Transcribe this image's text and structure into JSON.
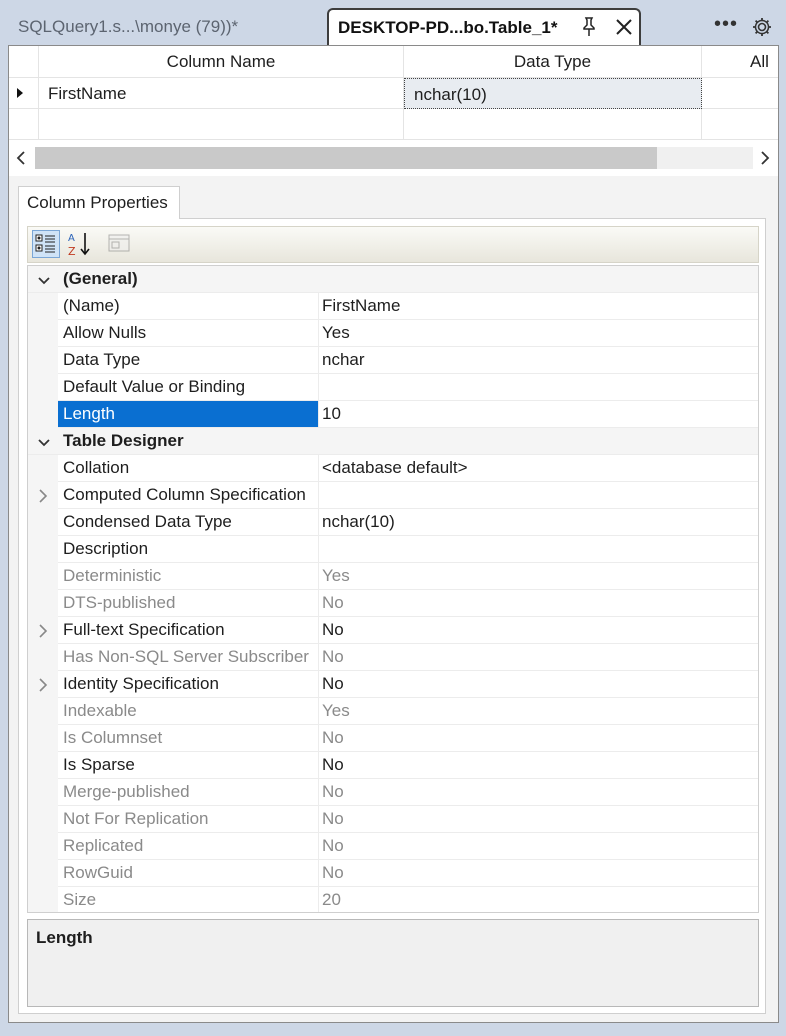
{
  "tabs": [
    {
      "label": "SQLQuery1.s...\\monye (79))*",
      "active": false
    },
    {
      "label": "DESKTOP-PD...bo.Table_1*",
      "active": true
    }
  ],
  "grid": {
    "headers": [
      "Column Name",
      "Data Type",
      "All"
    ],
    "rows": [
      {
        "name": "FirstName",
        "type": "nchar(10)"
      }
    ]
  },
  "column_properties": {
    "tab_label": "Column Properties",
    "categories": [
      {
        "label": "(General)",
        "rows": [
          {
            "name": "(Name)",
            "value": "FirstName",
            "dim": false,
            "expandable": false
          },
          {
            "name": "Allow Nulls",
            "value": "Yes",
            "dim": false,
            "expandable": false
          },
          {
            "name": "Data Type",
            "value": "nchar",
            "dim": false,
            "expandable": false
          },
          {
            "name": "Default Value or Binding",
            "value": "",
            "dim": false,
            "expandable": false
          },
          {
            "name": "Length",
            "value": "10",
            "dim": false,
            "expandable": false,
            "selected": true
          }
        ]
      },
      {
        "label": "Table Designer",
        "rows": [
          {
            "name": "Collation",
            "value": "<database default>",
            "dim": false,
            "expandable": false
          },
          {
            "name": "Computed Column Specification",
            "value": "",
            "dim": false,
            "expandable": true
          },
          {
            "name": "Condensed Data Type",
            "value": "nchar(10)",
            "dim": false,
            "expandable": false
          },
          {
            "name": "Description",
            "value": "",
            "dim": false,
            "expandable": false
          },
          {
            "name": "Deterministic",
            "value": "Yes",
            "dim": true,
            "expandable": false
          },
          {
            "name": "DTS-published",
            "value": "No",
            "dim": true,
            "expandable": false
          },
          {
            "name": "Full-text Specification",
            "value": "No",
            "dim": false,
            "expandable": true
          },
          {
            "name": "Has Non-SQL Server Subscriber",
            "value": "No",
            "dim": true,
            "expandable": false
          },
          {
            "name": "Identity Specification",
            "value": "No",
            "dim": false,
            "expandable": true
          },
          {
            "name": "Indexable",
            "value": "Yes",
            "dim": true,
            "expandable": false
          },
          {
            "name": "Is Columnset",
            "value": "No",
            "dim": true,
            "expandable": false
          },
          {
            "name": "Is Sparse",
            "value": "No",
            "dim": false,
            "expandable": false
          },
          {
            "name": "Merge-published",
            "value": "No",
            "dim": true,
            "expandable": false
          },
          {
            "name": "Not For Replication",
            "value": "No",
            "dim": true,
            "expandable": false
          },
          {
            "name": "Replicated",
            "value": "No",
            "dim": true,
            "expandable": false
          },
          {
            "name": "RowGuid",
            "value": "No",
            "dim": true,
            "expandable": false
          },
          {
            "name": "Size",
            "value": "20",
            "dim": true,
            "expandable": false
          }
        ]
      }
    ]
  },
  "description_title": "Length",
  "colors": {
    "selection": "#0a6fd1",
    "accent_frame": "#cdd7e6"
  }
}
